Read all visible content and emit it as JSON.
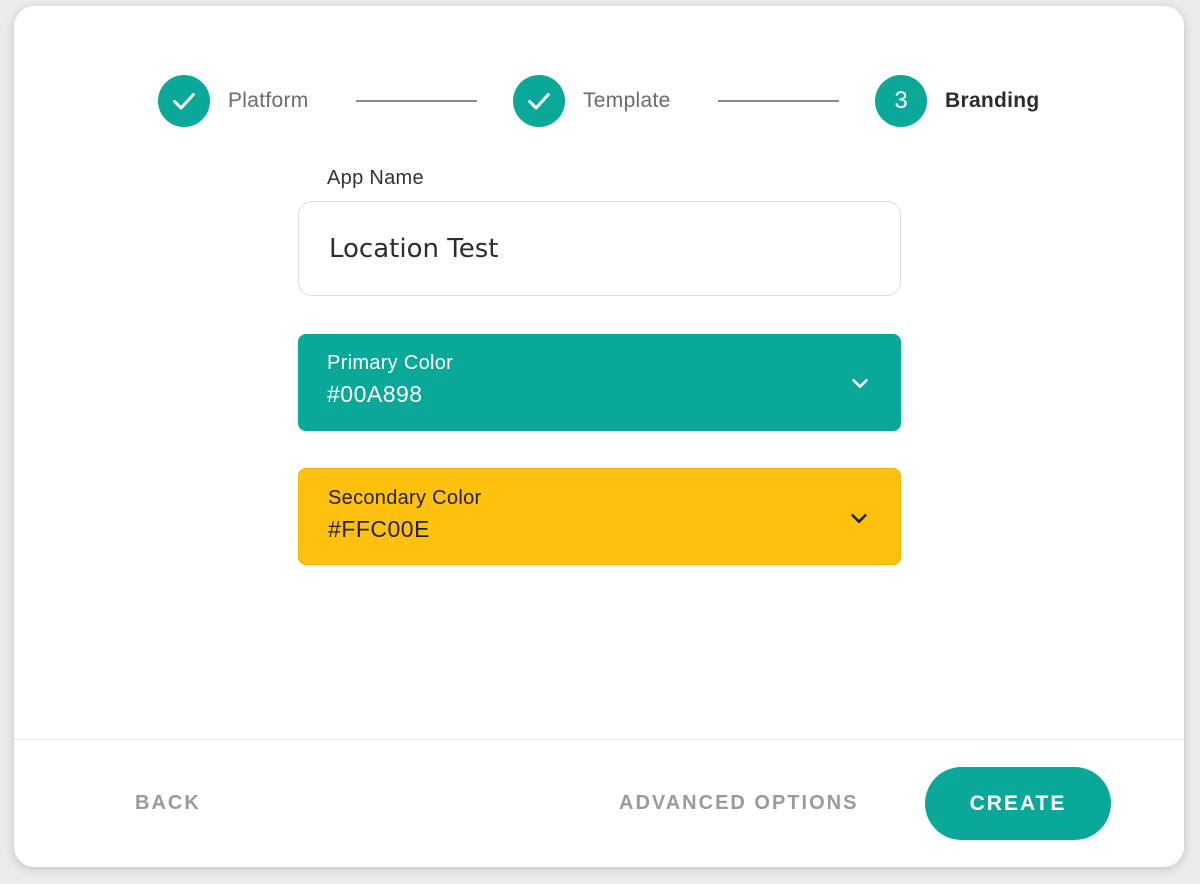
{
  "colors": {
    "accent": "#0AA898",
    "secondary": "#FFC00E"
  },
  "stepper": {
    "steps": [
      {
        "label": "Platform",
        "state": "complete",
        "icon": "check-icon"
      },
      {
        "label": "Template",
        "state": "complete",
        "icon": "check-icon"
      },
      {
        "label": "Branding",
        "state": "active",
        "number": "3"
      }
    ]
  },
  "form": {
    "app_name": {
      "label": "App Name",
      "value": "Location Test"
    },
    "primary_color": {
      "label": "Primary Color",
      "value": "#00A898",
      "icon": "chevron-down-icon"
    },
    "secondary_color": {
      "label": "Secondary Color",
      "value": "#FFC00E",
      "icon": "chevron-down-icon"
    }
  },
  "footer": {
    "back_label": "BACK",
    "advanced_label": "ADVANCED OPTIONS",
    "create_label": "CREATE"
  }
}
